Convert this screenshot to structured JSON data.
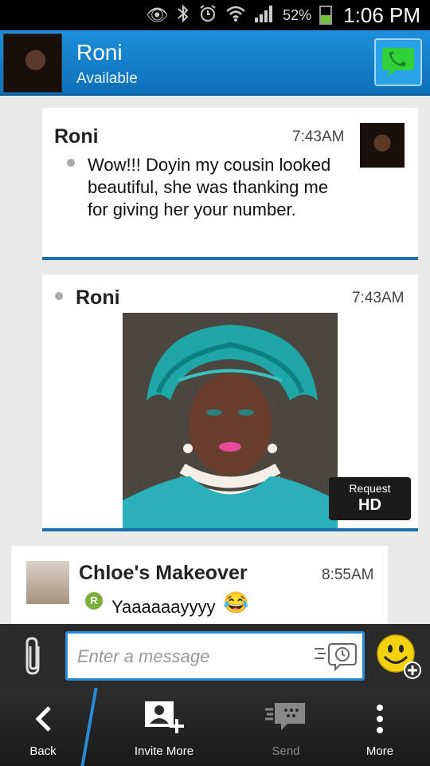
{
  "status_bar": {
    "battery_percent": "52%",
    "battery_level": 0.52,
    "time": "1:06 PM",
    "icons": [
      "eye-icon",
      "bluetooth-icon",
      "alarm-icon",
      "wifi-icon",
      "signal-icon"
    ]
  },
  "header": {
    "contact_name": "Roni",
    "contact_status": "Available",
    "call_icon": "phone-icon",
    "accent_color": "#1d8fdc"
  },
  "messages": [
    {
      "sender": "Roni",
      "time": "7:43AM",
      "text": "Wow!!! Doyin my cousin looked  beautiful, she was thanking  me for  giving  her your number."
    },
    {
      "sender": "Roni",
      "time": "7:43AM",
      "request_hd_line1": "Request",
      "request_hd_line2": "HD"
    },
    {
      "sender": "Chloe's Makeover",
      "time": "8:55AM",
      "badge": "R",
      "text": "Yaaaaaayyyy"
    }
  ],
  "input": {
    "placeholder": "Enter a message"
  },
  "nav": {
    "back": "Back",
    "invite_more": "Invite More",
    "send": "Send",
    "more": "More"
  }
}
